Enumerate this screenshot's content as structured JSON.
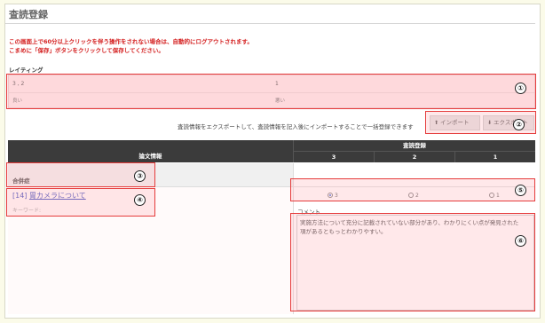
{
  "page": {
    "title": "査読登録",
    "warning_line1": "この画面上で60分以上クリックを伴う操作をされない場合は、自動的にログアウトされます。",
    "warning_line2": "こまめに「保存」ボタンをクリックして保存してください。"
  },
  "rating": {
    "label": "レイティング",
    "scale_high": "3 , 2",
    "scale_low": "1",
    "desc_good": "良い",
    "desc_bad": "悪い"
  },
  "export": {
    "note": "査読情報をエクスポートして、査読情報を記入後にインポートすることで一括登録できます",
    "import_label": "インポート",
    "export_label": "エクスポート"
  },
  "table": {
    "header_left": "論文情報",
    "header_right": "査読登録",
    "columns": [
      "3",
      "2",
      "1"
    ]
  },
  "row": {
    "category": "合併症",
    "item_id": "[14]",
    "item_title": "胃カメラについて",
    "keywords_label": "キーワード:",
    "radio_options": [
      "3",
      "2",
      "1"
    ],
    "selected": "3",
    "comment_label": "コメント",
    "comment_text": "実施方法について充分に記載されていない部分があり、わかりにくい点が発見された\n項があるともっとわかりやすい。"
  },
  "annotations": [
    "①",
    "②",
    "③",
    "④",
    "⑤",
    "⑥"
  ],
  "colors": {
    "warning": "#d42020",
    "highlight": "#e53b3b",
    "header_bg": "#3b3b3b",
    "link": "#2e3fb9",
    "rating_bg": "#fde8ea"
  },
  "icons": {
    "import": "upload-icon",
    "export": "download-icon"
  }
}
